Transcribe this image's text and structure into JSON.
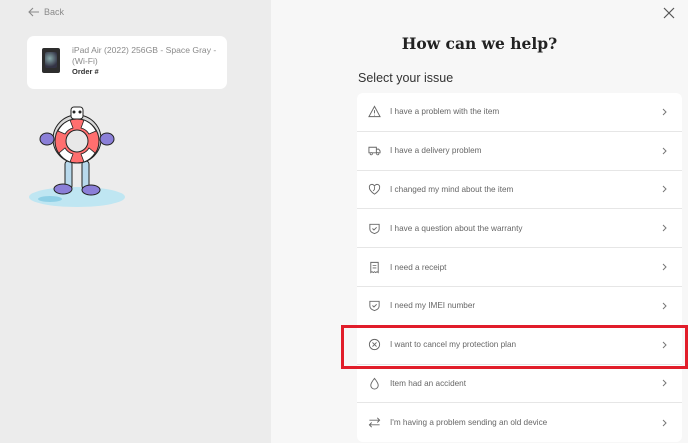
{
  "nav": {
    "back_label": "Back"
  },
  "product": {
    "name": "iPad Air (2022) 256GB - Space Gray - (Wi-Fi)",
    "order_label": "Order #"
  },
  "panel": {
    "title": "How can we help?",
    "subtitle": "Select your issue"
  },
  "issues": [
    {
      "icon": "warning-triangle-icon",
      "label": "I have a problem with the item"
    },
    {
      "icon": "truck-icon",
      "label": "I have a delivery problem"
    },
    {
      "icon": "heart-icon",
      "label": "I changed my mind about the item"
    },
    {
      "icon": "shield-icon",
      "label": "I have a question about the warranty"
    },
    {
      "icon": "receipt-icon",
      "label": "I need a receipt"
    },
    {
      "icon": "shield-icon",
      "label": "I need my IMEI number"
    },
    {
      "icon": "cancel-circle-icon",
      "label": "I want to cancel my protection plan"
    },
    {
      "icon": "droplet-icon",
      "label": "Item had an accident"
    },
    {
      "icon": "swap-arrows-icon",
      "label": "I'm having a problem sending an old device"
    }
  ],
  "highlight_color": "#e11d2a"
}
